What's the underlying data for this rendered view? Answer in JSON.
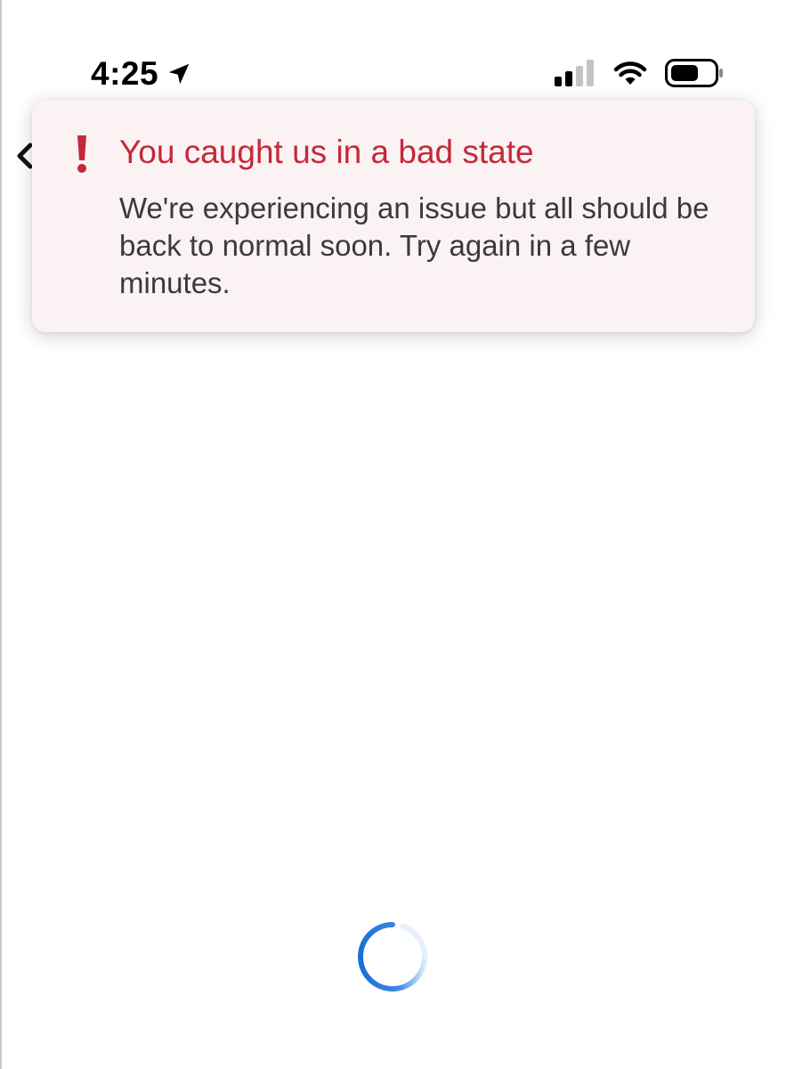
{
  "status_bar": {
    "time": "4:25",
    "icons": [
      "location-arrow-icon",
      "signal-icon",
      "wifi-icon",
      "battery-icon"
    ]
  },
  "background": {
    "icons": [
      "back-chevron-icon"
    ]
  },
  "error_toast": {
    "icon": "exclamation-icon",
    "title": "You caught us in a bad state",
    "message": "We're experiencing an issue but all should be back to normal soon. Try again in a few minutes."
  },
  "loading": {
    "icon": "loading-spinner-icon"
  },
  "colors": {
    "error_red": "#c5283a",
    "toast_background": "#fbf2f3",
    "body_text": "#3a3a3c",
    "spinner_blue": "#1a6fd8"
  }
}
